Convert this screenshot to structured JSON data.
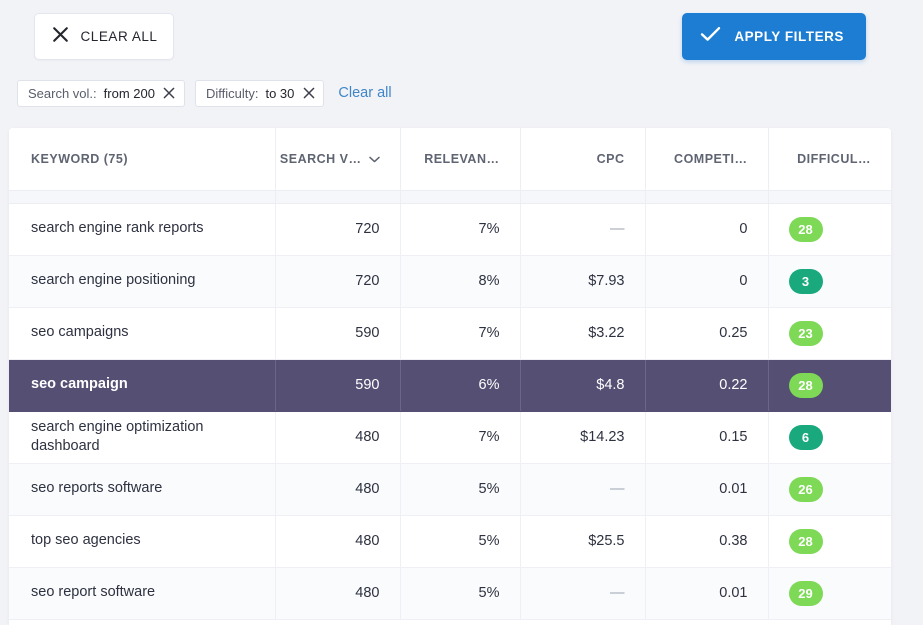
{
  "toolbar": {
    "clear_all_label": "CLEAR ALL",
    "clear_all_icon": "close-x-icon",
    "apply_filters_label": "APPLY FILTERS",
    "apply_filters_icon": "check-icon",
    "apply_filters_color": "#1d7dd3"
  },
  "filters": {
    "chips": [
      {
        "label": "Search vol.:",
        "value": "from 200",
        "close_icon": "close-x-icon"
      },
      {
        "label": "Difficulty:",
        "value": "to 30",
        "close_icon": "close-x-icon"
      }
    ],
    "clear_all_link": "Clear all",
    "clear_all_link_color": "#3f86c8"
  },
  "table": {
    "columns": [
      {
        "key": "keyword",
        "label": "KEYWORD  (75)",
        "align": "left",
        "sortable": false
      },
      {
        "key": "search_vol",
        "label": "SEARCH V…",
        "align": "right",
        "sortable": true,
        "sort_icon": "chevron-down-icon"
      },
      {
        "key": "relevance",
        "label": "RELEVAN…",
        "align": "right",
        "sortable": false
      },
      {
        "key": "cpc",
        "label": "CPC",
        "align": "right",
        "sortable": false
      },
      {
        "key": "competition",
        "label": "COMPETI…",
        "align": "right",
        "sortable": false
      },
      {
        "key": "difficulty",
        "label": "DIFFICUL…",
        "align": "right",
        "sortable": false
      }
    ],
    "keyword_count": "75",
    "selected_row_index": 3,
    "selected_row_color": "#564f74",
    "badge_colors": {
      "low": "#19a97c",
      "medium": "#7ed957"
    },
    "rows": [
      {
        "keyword": "search engine rank reports",
        "search_vol": "720",
        "relevance": "7%",
        "cpc": "—",
        "competition": "0",
        "difficulty": "28",
        "difficulty_level": "medium"
      },
      {
        "keyword": "search engine positioning",
        "search_vol": "720",
        "relevance": "8%",
        "cpc": "$7.93",
        "competition": "0",
        "difficulty": "3",
        "difficulty_level": "low"
      },
      {
        "keyword": "seo campaigns",
        "search_vol": "590",
        "relevance": "7%",
        "cpc": "$3.22",
        "competition": "0.25",
        "difficulty": "23",
        "difficulty_level": "medium"
      },
      {
        "keyword": "seo campaign",
        "search_vol": "590",
        "relevance": "6%",
        "cpc": "$4.8",
        "competition": "0.22",
        "difficulty": "28",
        "difficulty_level": "medium"
      },
      {
        "keyword": "search engine optimization dashboard",
        "search_vol": "480",
        "relevance": "7%",
        "cpc": "$14.23",
        "competition": "0.15",
        "difficulty": "6",
        "difficulty_level": "low"
      },
      {
        "keyword": "seo reports software",
        "search_vol": "480",
        "relevance": "5%",
        "cpc": "—",
        "competition": "0.01",
        "difficulty": "26",
        "difficulty_level": "medium"
      },
      {
        "keyword": "top seo agencies",
        "search_vol": "480",
        "relevance": "5%",
        "cpc": "$25.5",
        "competition": "0.38",
        "difficulty": "28",
        "difficulty_level": "medium"
      },
      {
        "keyword": "seo report software",
        "search_vol": "480",
        "relevance": "5%",
        "cpc": "—",
        "competition": "0.01",
        "difficulty": "29",
        "difficulty_level": "medium"
      }
    ]
  }
}
